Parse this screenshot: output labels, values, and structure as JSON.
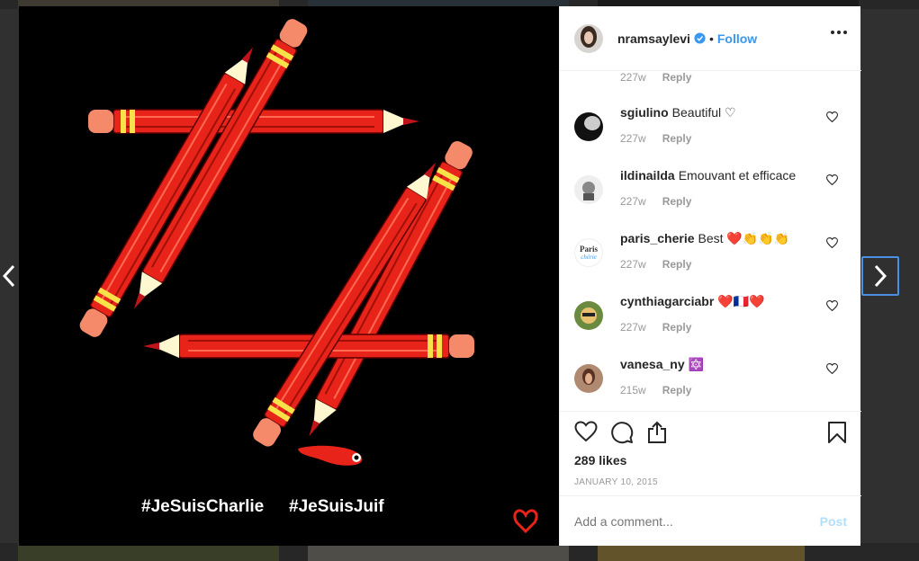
{
  "post": {
    "username": "nramsaylevi",
    "follow_label": "Follow",
    "separator": "•",
    "media": {
      "hashtag1": "#JeSuisCharlie",
      "hashtag2": "#JeSuisJuif"
    },
    "partial_comment": {
      "time": "227w",
      "reply_label": "Reply"
    },
    "comments": [
      {
        "user": "sgiulino",
        "text": "Beautiful ♡",
        "time": "227w",
        "reply_label": "Reply"
      },
      {
        "user": "ildinailda",
        "text": "Emouvant et efficace",
        "time": "227w",
        "reply_label": "Reply"
      },
      {
        "user": "paris_cherie",
        "text": "Best ❤️👏👏👏",
        "time": "227w",
        "reply_label": "Reply",
        "avatar_text1": "Paris",
        "avatar_text2": "chérie"
      },
      {
        "user": "cynthiagarciabr",
        "text": "❤️🇫🇷❤️",
        "time": "227w",
        "reply_label": "Reply"
      },
      {
        "user": "vanesa_ny",
        "text": "🔯",
        "time": "215w",
        "reply_label": "Reply"
      }
    ],
    "likes": "289 likes",
    "date": "JANUARY 10, 2015",
    "add_comment_placeholder": "Add a comment...",
    "post_label": "Post"
  },
  "colors": {
    "accent": "#3897f0",
    "pencil": "#e8241a",
    "text": "#262626",
    "muted": "#999999"
  },
  "icons": [
    "verified-icon",
    "more-options-icon",
    "heart-icon",
    "comment-icon",
    "share-icon",
    "bookmark-icon",
    "chevron-left-icon",
    "chevron-right-icon"
  ]
}
